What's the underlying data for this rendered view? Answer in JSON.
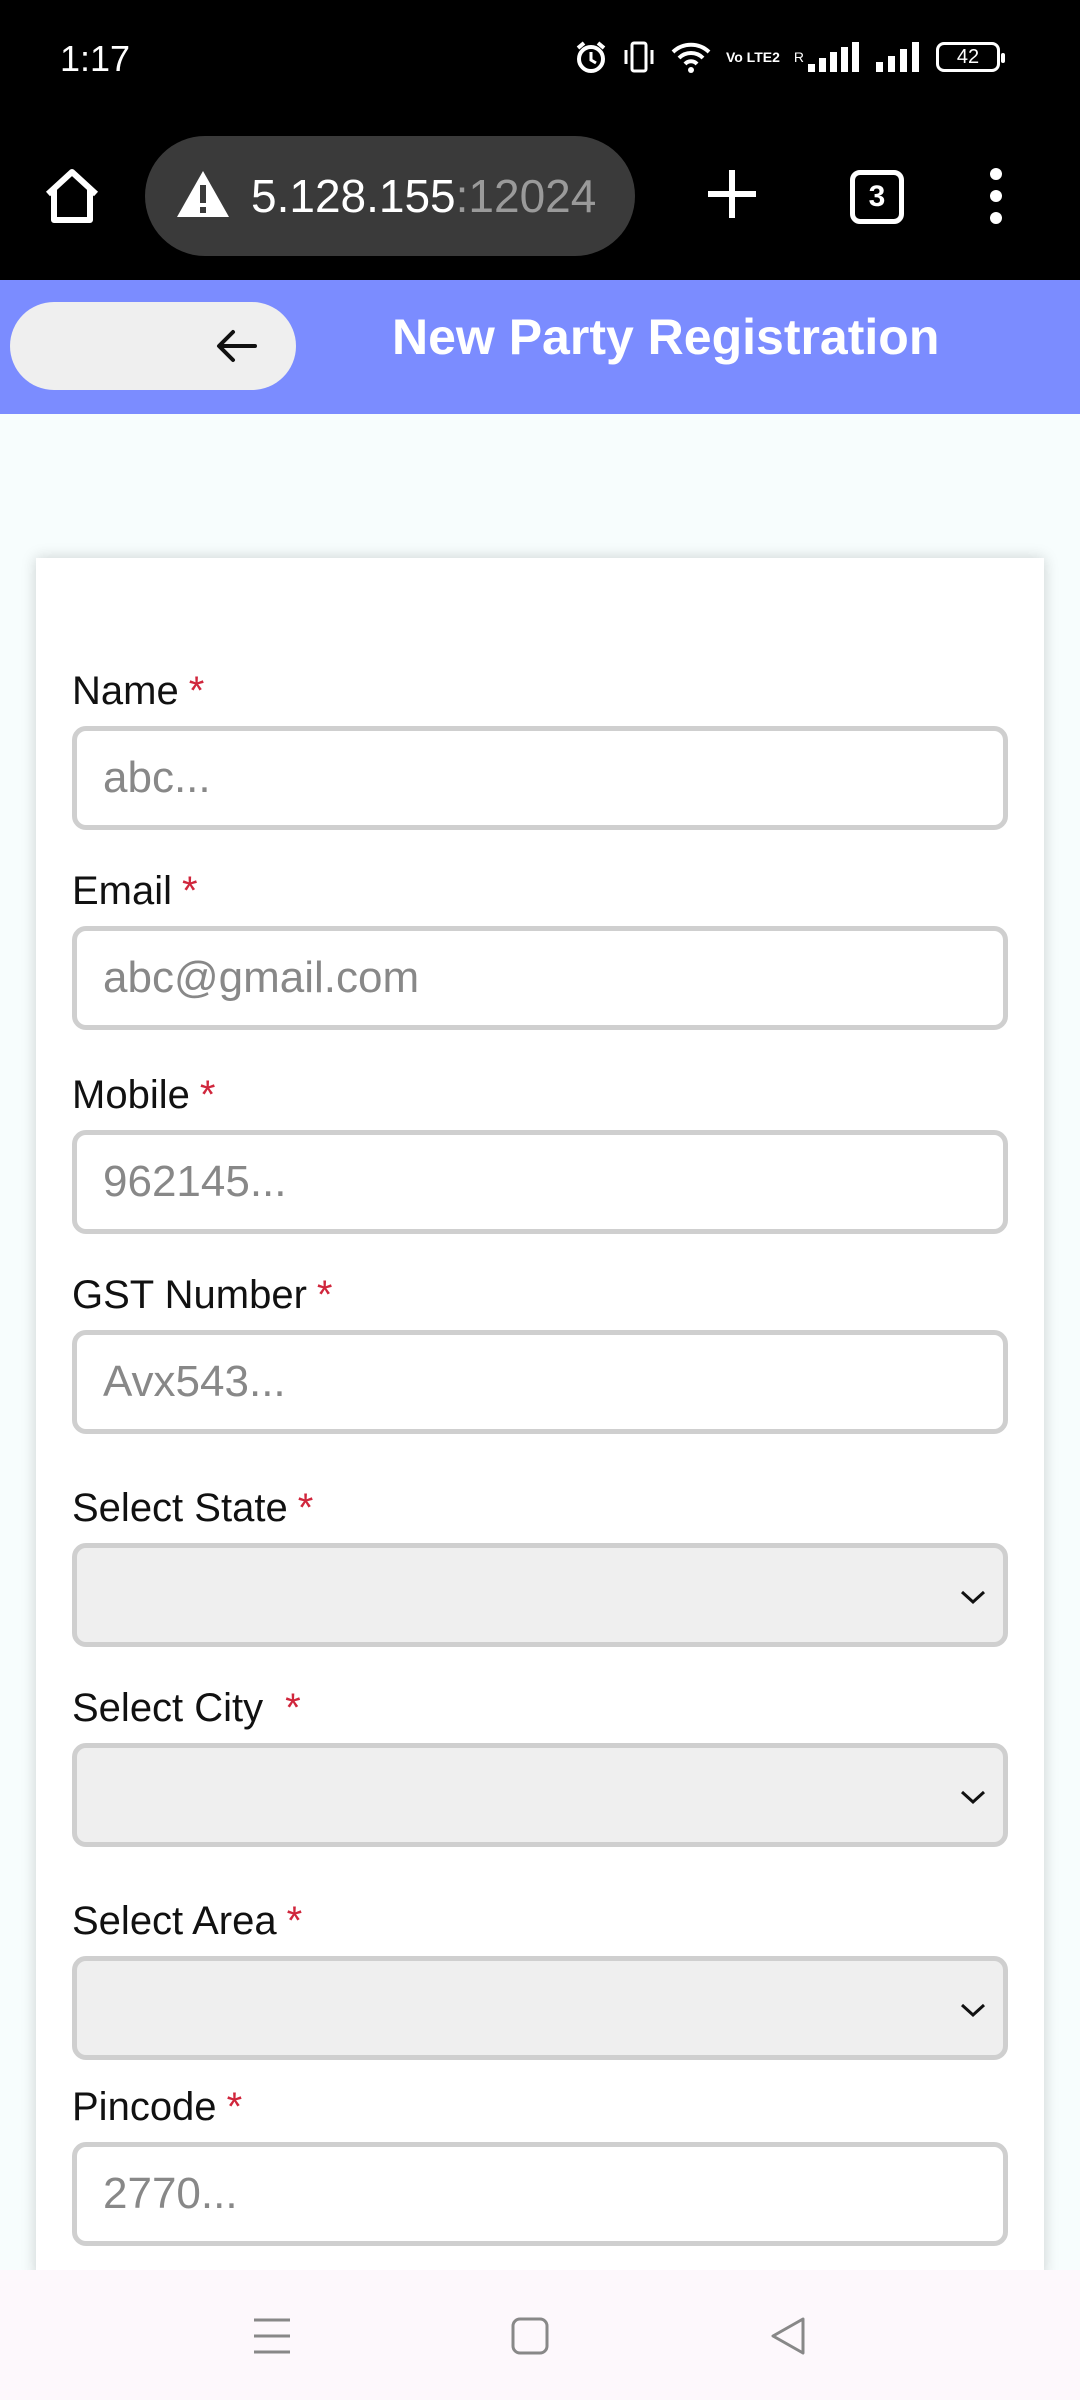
{
  "status_bar": {
    "time": "1:17",
    "battery": "42",
    "icons": [
      "alarm-icon",
      "vibrate-icon",
      "wifi-icon",
      "volte-icon",
      "signal-icon",
      "signal-icon",
      "battery-icon"
    ],
    "volte_text": "Vo LTE2",
    "roaming": "R"
  },
  "browser": {
    "url_host": "5.128.155",
    "url_port": ":12024",
    "tab_count": "3",
    "icons": [
      "home-icon",
      "warning-icon",
      "plus-icon",
      "tabs-icon",
      "menu-icon"
    ]
  },
  "header": {
    "title": "New Party Registration",
    "back_icon": "arrow-left-icon",
    "background": "#7b8cff"
  },
  "form": {
    "fields": [
      {
        "label": "Name",
        "required": "*",
        "placeholder": "abc...",
        "type": "input"
      },
      {
        "label": "Email",
        "required": "*",
        "placeholder": "abc@gmail.com",
        "type": "input"
      },
      {
        "label": "Mobile",
        "required": "*",
        "placeholder": "962145...",
        "type": "input"
      },
      {
        "label": "GST Number",
        "required": "*",
        "placeholder": "Avx543...",
        "type": "input"
      },
      {
        "label": "Select State",
        "required": "*",
        "value": "",
        "type": "select"
      },
      {
        "label": "Select City",
        "required": "*",
        "value": "",
        "type": "select"
      },
      {
        "label": "Select Area",
        "required": "*",
        "value": "",
        "type": "select"
      },
      {
        "label": "Pincode",
        "required": "*",
        "placeholder": "2770...",
        "type": "input"
      }
    ],
    "required_color": "#d0263c"
  },
  "nav": {
    "icons": [
      "recent-apps-icon",
      "home-square-icon",
      "back-triangle-icon"
    ]
  }
}
